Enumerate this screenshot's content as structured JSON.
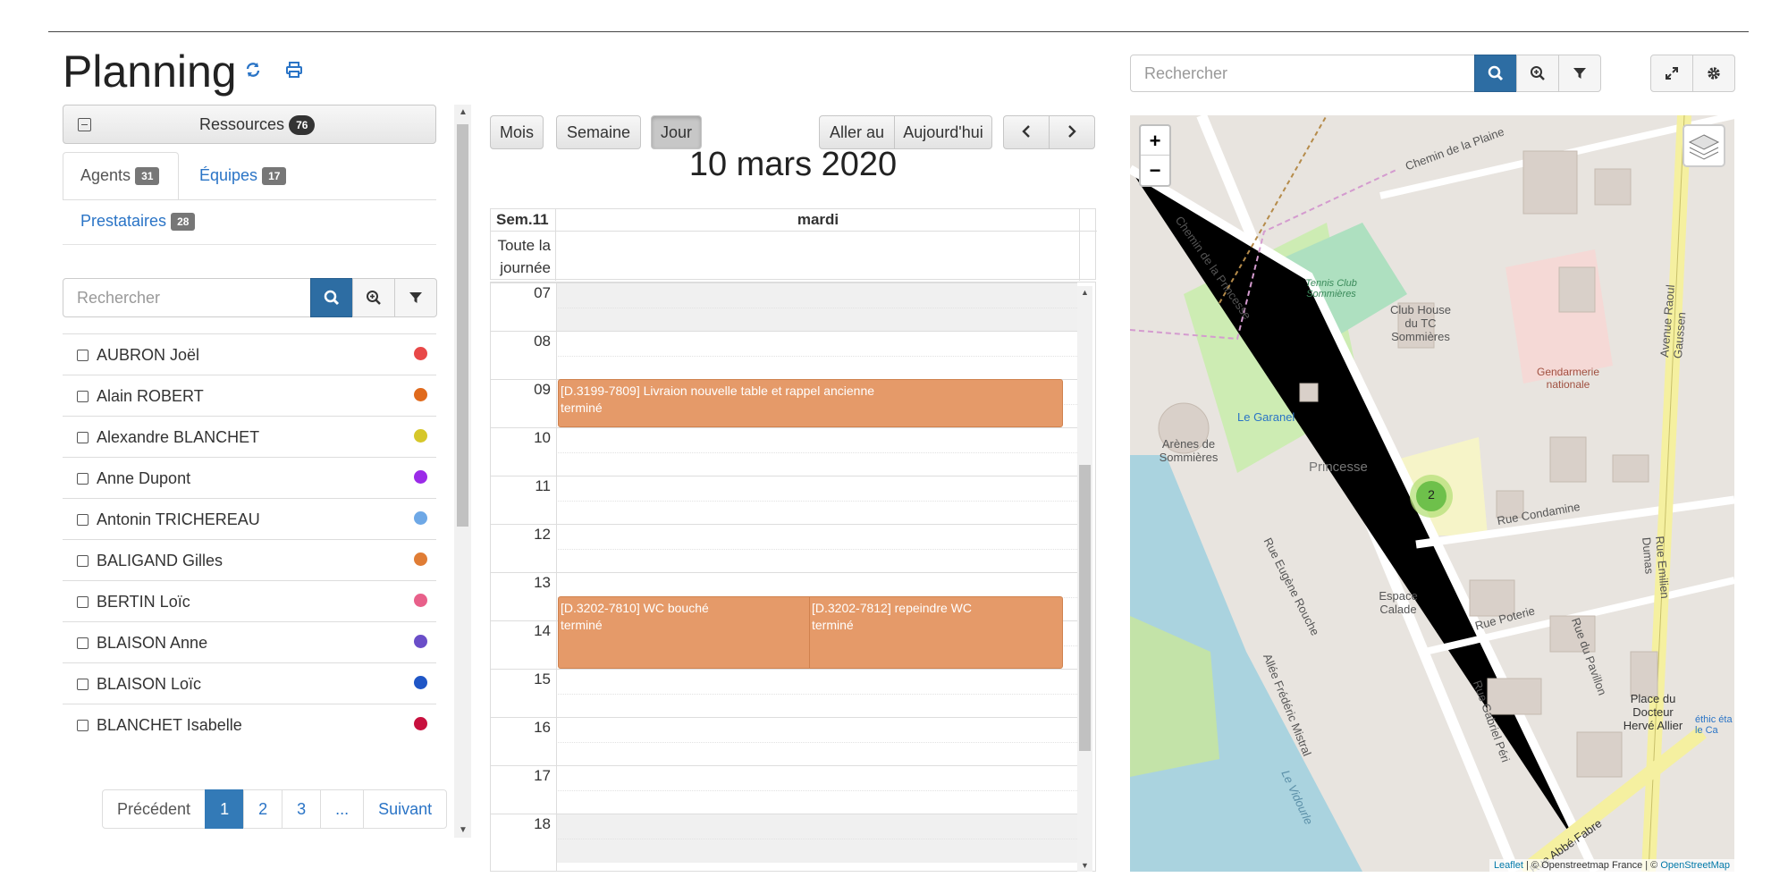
{
  "page": {
    "title": "Planning"
  },
  "resources": {
    "label": "Ressources",
    "count": "76",
    "tabs": [
      {
        "label": "Agents",
        "count": "31"
      },
      {
        "label": "Équipes",
        "count": "17"
      },
      {
        "label": "Prestataires",
        "count": "28"
      }
    ],
    "search_placeholder": "Rechercher",
    "agents": [
      {
        "name": "AUBRON Joël",
        "color": "#e84848"
      },
      {
        "name": "Alain ROBERT",
        "color": "#e06a1c"
      },
      {
        "name": "Alexandre BLANCHET",
        "color": "#d6c72a"
      },
      {
        "name": "Anne Dupont",
        "color": "#9b2be8"
      },
      {
        "name": "Antonin TRICHEREAU",
        "color": "#6ea8e6"
      },
      {
        "name": "BALIGAND Gilles",
        "color": "#e07d35"
      },
      {
        "name": "BERTIN Loïc",
        "color": "#e8608a"
      },
      {
        "name": "BLAISON Anne",
        "color": "#6a4ec8"
      },
      {
        "name": "BLAISON Loïc",
        "color": "#1f56c6"
      },
      {
        "name": "BLANCHET Isabelle",
        "color": "#c8103e"
      }
    ],
    "pagination": [
      "Précédent",
      "1",
      "2",
      "3",
      "...",
      "Suivant"
    ]
  },
  "calendar": {
    "views": [
      "Mois",
      "Semaine",
      "Jour"
    ],
    "active_view": "Jour",
    "goto_label": "Aller au",
    "today_label": "Aujourd'hui",
    "prev_icon": "chevron-left-icon",
    "next_icon": "chevron-right-icon",
    "date_title": "10 mars 2020",
    "week_label": "Sem.11",
    "day_label": "mardi",
    "allday_label": "Toute la journée",
    "hours": [
      "07",
      "08",
      "09",
      "10",
      "11",
      "12",
      "13",
      "14",
      "15",
      "16",
      "17",
      "18"
    ],
    "events": [
      {
        "title": "[D.3199-7809] Livraion nouvelle table et rappel ancienne",
        "status": "terminé"
      },
      {
        "title": "[D.3202-7810] WC bouché",
        "status": "terminé"
      },
      {
        "title": "[D.3202-7812] repeindre WC",
        "status": "terminé"
      }
    ]
  },
  "map": {
    "search_placeholder": "Rechercher",
    "zoom_in": "+",
    "zoom_out": "−",
    "cluster_count": "2",
    "attribution": {
      "leaflet": "Leaflet",
      "text": " | © Openstreetmap France | © ",
      "osm": "OpenStreetMap"
    },
    "labels": {
      "chemin_plaine": "Chemin de la Plaine",
      "chemin_princesse": "Chemin de la Princesse",
      "tennis": "Tennis Club Sommières",
      "club_house": "Club House du TC Sommières",
      "gendarmerie": "Gendarmerie nationale",
      "garanel": "Le Garanel",
      "arenes": "Arènes de Sommières",
      "princesse": "Princesse",
      "rue_condamine": "Rue Condamine",
      "rue_eugene_rouche": "Rue Eugène Rouche",
      "espace_calade": "Espace Calade",
      "rue_poterie": "Rue Poterie",
      "rue_pavillon": "Rue du Pavillon",
      "avenue_raoul": "Avenue Raoul Gaussen",
      "rue_emilien": "Rue Emilien Dumas",
      "allee_mistral": "Allée Frédéric Mistral",
      "rue_peri": "Rue Gabriel Péri",
      "place_docteur": "Place du Docteur Hervé Allier",
      "le_vidourle": "Le Vidourle",
      "rue_abbe": "Rue Abbé Fabre",
      "ethic": "éthic éta le Ca"
    }
  }
}
